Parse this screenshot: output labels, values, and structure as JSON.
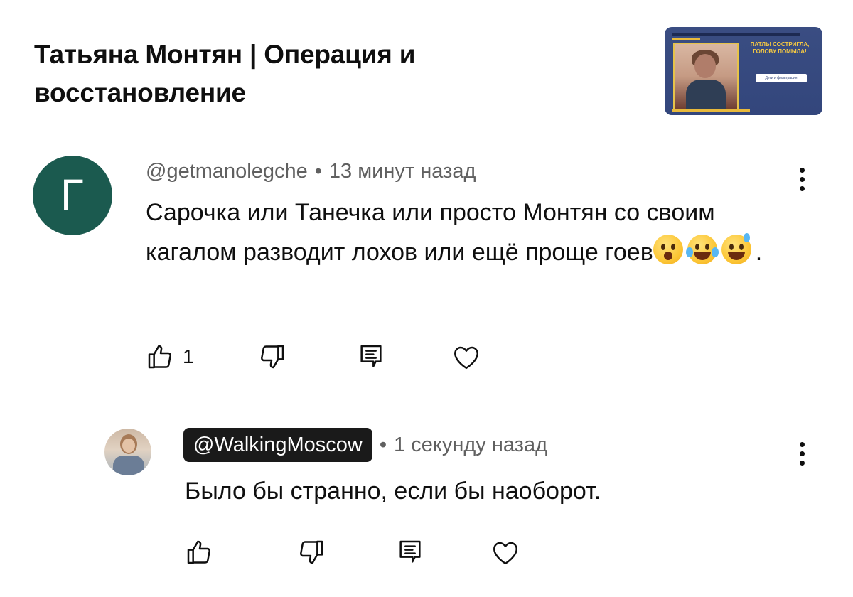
{
  "video": {
    "title": "Татьяна Монтян | Операция и восстановление",
    "thumbnail": {
      "headline": "ПАТЛЫ СОСТРИГЛА, ГОЛОВУ ПОМЫЛА!",
      "tag": "Дети и фильтрация"
    }
  },
  "comments": [
    {
      "avatar_letter": "Г",
      "handle": "@getmanolegche",
      "time": "13 минут назад",
      "text": "Сарочка или Танечка или просто Монтян со своим кагалом разводит лохов или ещё проще гоев",
      "emojis": [
        "hushed-face-emoji",
        "tears-of-joy-emoji",
        "grinning-sweat-emoji"
      ],
      "text_suffix": ".",
      "likes": "1"
    },
    {
      "avatar": "user-photo-avatar",
      "handle": "@WalkingMoscow",
      "time": "1 секунду назад",
      "text": "Было бы странно, если бы наоборот.",
      "likes": ""
    }
  ]
}
